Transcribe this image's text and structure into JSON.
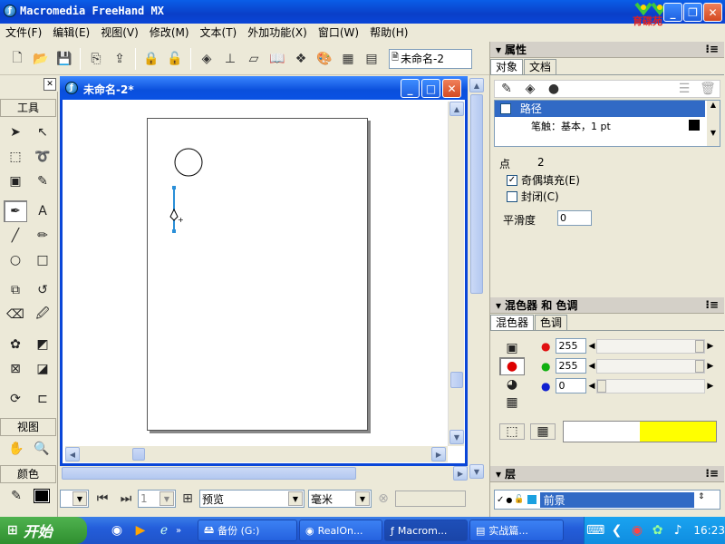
{
  "window": {
    "title": "Macromedia FreeHand MX",
    "watermark": "育碟苑"
  },
  "menu": [
    "文件(F)",
    "编辑(E)",
    "视图(V)",
    "修改(M)",
    "文本(T)",
    "外加功能(X)",
    "窗口(W)",
    "帮助(H)"
  ],
  "toolbar": {
    "doc_select": "未命名-2"
  },
  "tools": {
    "title": "工具",
    "view_title": "视图",
    "color_title": "颜色"
  },
  "document": {
    "title": "未命名-2*"
  },
  "statusbar": {
    "page_value": "1",
    "mode": "预览",
    "units": "毫米"
  },
  "properties": {
    "title": "属性",
    "tabs": [
      "对象",
      "文档"
    ],
    "tree": {
      "path": "路径",
      "stroke": "笔触：基本，1 pt"
    },
    "points_label": "点",
    "points_value": "2",
    "evenodd_label": "奇偶填充(E)",
    "closed_label": "封闭(C)",
    "flatness_label": "平滑度",
    "flatness_value": "0"
  },
  "mixer": {
    "title": "混色器 和 色调",
    "tabs": [
      "混色器",
      "色调"
    ],
    "r": "255",
    "g": "255",
    "b": "0",
    "result_color": "#ffff00"
  },
  "layers": {
    "title": "层",
    "layer_name": "前景"
  },
  "taskbar": {
    "start": "开始",
    "tasks": [
      "备份 (G:)",
      "RealOn...",
      "Macrom...",
      "实战篇..."
    ],
    "clock": "16:23"
  }
}
